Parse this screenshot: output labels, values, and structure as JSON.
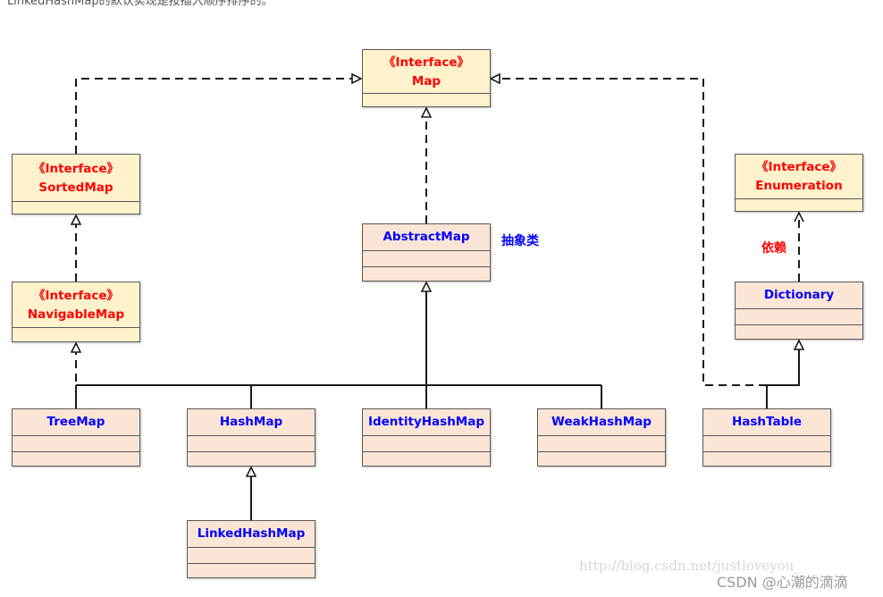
{
  "intro_text": "LinkedHashMap的默认实现是按插入顺序排序的。",
  "diagram": {
    "stereotype": "《Interface》",
    "interfaces": {
      "map": "Map",
      "sorted_map": "SortedMap",
      "navigable_map": "NavigableMap",
      "enumeration": "Enumeration"
    },
    "classes": {
      "abstract_map": "AbstractMap",
      "dictionary": "Dictionary",
      "tree_map": "TreeMap",
      "hash_map": "HashMap",
      "identity_hash_map": "IdentityHashMap",
      "weak_hash_map": "WeakHashMap",
      "hash_table": "HashTable",
      "linked_hash_map": "LinkedHashMap"
    },
    "annotations": {
      "abstract_class": "抽象类",
      "dependency": "依赖"
    },
    "relationships": [
      {
        "from": "SortedMap",
        "to": "Map",
        "type": "realization"
      },
      {
        "from": "AbstractMap",
        "to": "Map",
        "type": "realization"
      },
      {
        "from": "HashTable",
        "to": "Map",
        "type": "realization"
      },
      {
        "from": "NavigableMap",
        "to": "SortedMap",
        "type": "realization"
      },
      {
        "from": "TreeMap",
        "to": "NavigableMap",
        "type": "realization"
      },
      {
        "from": "TreeMap",
        "to": "AbstractMap",
        "type": "generalization"
      },
      {
        "from": "HashMap",
        "to": "AbstractMap",
        "type": "generalization"
      },
      {
        "from": "IdentityHashMap",
        "to": "AbstractMap",
        "type": "generalization"
      },
      {
        "from": "WeakHashMap",
        "to": "AbstractMap",
        "type": "generalization"
      },
      {
        "from": "LinkedHashMap",
        "to": "HashMap",
        "type": "generalization"
      },
      {
        "from": "HashTable",
        "to": "Dictionary",
        "type": "generalization"
      },
      {
        "from": "Dictionary",
        "to": "Enumeration",
        "type": "dependency"
      }
    ],
    "colors": {
      "interface_fill": "#fff2cc",
      "class_fill": "#fbe5d6",
      "interface_text": "#ff0000",
      "class_text": "#0000ff",
      "line": "#1a1a1a"
    }
  },
  "watermark": {
    "url": "http://blog.csdn.net/justloveyou_",
    "credit": "CSDN @心潮的滴滴"
  }
}
